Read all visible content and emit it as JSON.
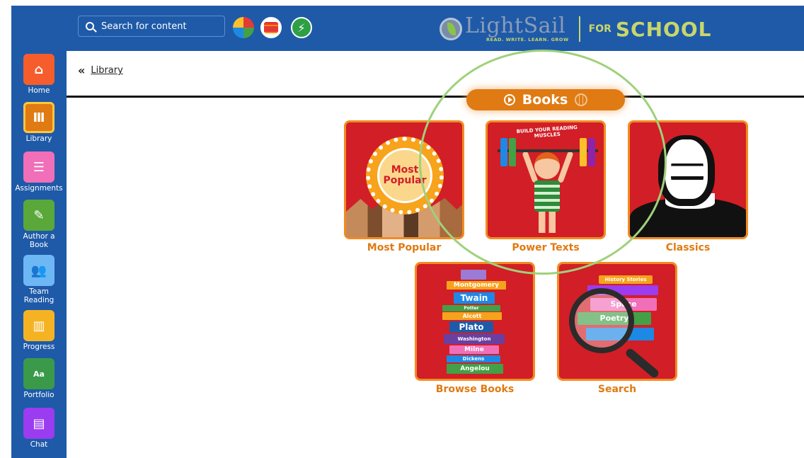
{
  "topbar": {
    "search_placeholder": "Search for content",
    "icons": [
      "color-wheel-icon",
      "book-stack-icon",
      "lightning-icon"
    ],
    "logo": {
      "name": "LightSail",
      "tagline": "READ. WRITE. LEARN. GROW",
      "for": "FOR",
      "school": "SCHOOL"
    },
    "colors": {
      "bar": "#1e5aa8",
      "logo_accent": "#c8d66b"
    }
  },
  "sidebar": {
    "items": [
      {
        "label": "Home",
        "icon": "home-icon",
        "color": "#f55d2c",
        "active": false
      },
      {
        "label": "Library",
        "icon": "library-icon",
        "color": "#e07a12",
        "active": true
      },
      {
        "label": "Assignments",
        "icon": "clipboard-icon",
        "color": "#f06fb8",
        "active": false
      },
      {
        "label": "Author a Book",
        "icon": "pencil-icon",
        "color": "#5aa83a",
        "active": false
      },
      {
        "label": "Team Reading",
        "icon": "team-icon",
        "color": "#6eb7f5",
        "active": false
      },
      {
        "label": "Progress",
        "icon": "chart-icon",
        "color": "#f5b324",
        "active": false
      },
      {
        "label": "Portfolio",
        "icon": "portfolio-icon",
        "color": "#3a9a4a",
        "active": false
      },
      {
        "label": "Chat",
        "icon": "chat-icon",
        "color": "#9b3cf0",
        "active": false
      }
    ]
  },
  "main": {
    "breadcrumb": {
      "chevron": "«",
      "label": "Library"
    },
    "section_tab": {
      "label": "Books"
    },
    "tiles": [
      {
        "label": "Most Popular",
        "art": {
          "medal_text_1": "Most",
          "medal_text_2": "Popular"
        }
      },
      {
        "label": "Power Texts",
        "art": {
          "banner": "BUILD YOUR READING MUSCLES"
        }
      },
      {
        "label": "Classics"
      },
      {
        "label": "Browse Books",
        "art": {
          "books": [
            "Montgomery",
            "Twain",
            "Potter",
            "Alcott",
            "Plato",
            "Washington",
            "Milne",
            "Dickens",
            "Angelou"
          ]
        }
      },
      {
        "label": "Search",
        "art": {
          "books": [
            "History Stories",
            "Space",
            "Poetry"
          ]
        }
      }
    ],
    "colors": {
      "tile_bg": "#d21e26",
      "tile_border": "#f28b21",
      "label": "#e07a12"
    }
  }
}
